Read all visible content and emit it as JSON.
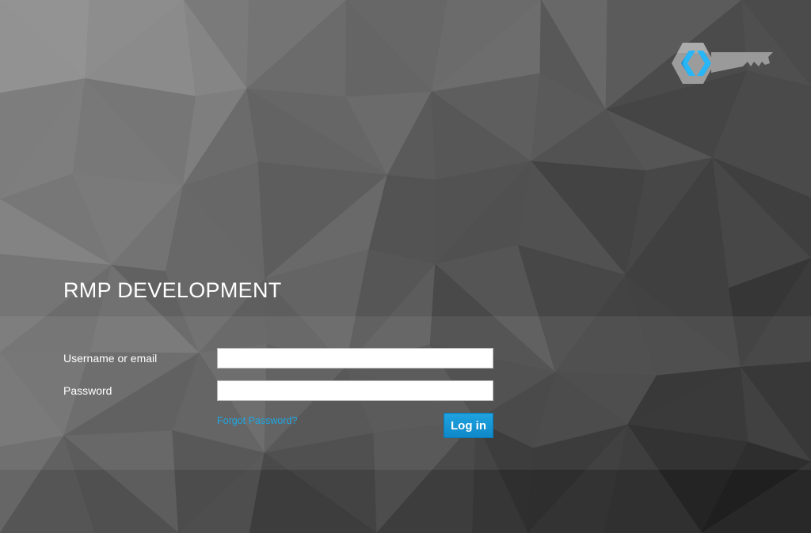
{
  "realm": {
    "title": "RMP DEVELOPMENT"
  },
  "login_form": {
    "username_label": "Username or email",
    "username_value": "",
    "password_label": "Password",
    "password_value": "",
    "forgot_password_label": "Forgot Password?",
    "login_button_label": "Log in"
  },
  "logo": {
    "icon": "keycloak-logo-icon",
    "accent_color": "#29b6f6"
  },
  "colors": {
    "accent": "#1ea7e4",
    "button": "#0f88c8",
    "background_dark": "#1e1e1e",
    "background_light": "#8a8a8a"
  }
}
